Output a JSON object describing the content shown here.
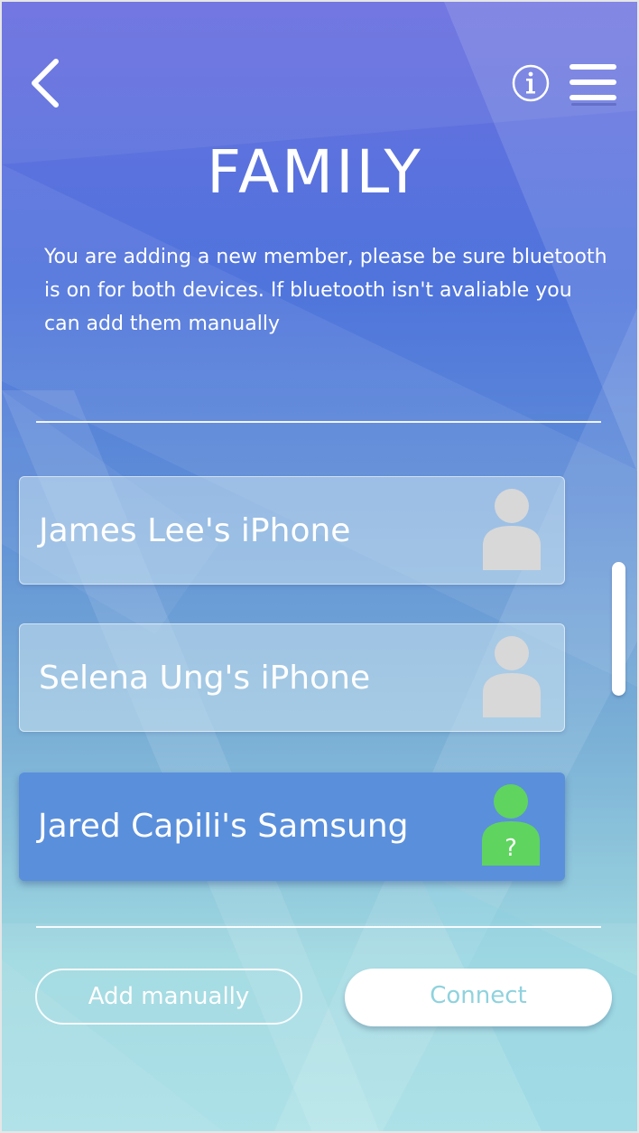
{
  "header": {
    "title": "FAMILY",
    "back_icon": "chevron-left-icon",
    "info_icon": "info-circle-icon",
    "menu_icon": "hamburger-menu-icon"
  },
  "intro": {
    "text": "You are adding a new member, please be sure bluetooth is on for both devices. If bluetooth isn't avaliable you can add them manually"
  },
  "devices": [
    {
      "name": "James Lee's iPhone",
      "state": "idle",
      "avatar_icon": "person-icon"
    },
    {
      "name": "Selena Ung's iPhone",
      "state": "idle",
      "avatar_icon": "person-icon"
    },
    {
      "name": "Jared Capili's Samsung",
      "state": "selected",
      "avatar_icon": "person-unknown-icon",
      "avatar_mark": "?"
    }
  ],
  "actions": {
    "add_manually_label": "Add manually",
    "connect_label": "Connect"
  },
  "colors": {
    "selected_card": "#5a8fdc",
    "avatar_gray": "#d8d8d8",
    "avatar_green": "#5fd45f",
    "connect_text": "#8fd2de"
  }
}
